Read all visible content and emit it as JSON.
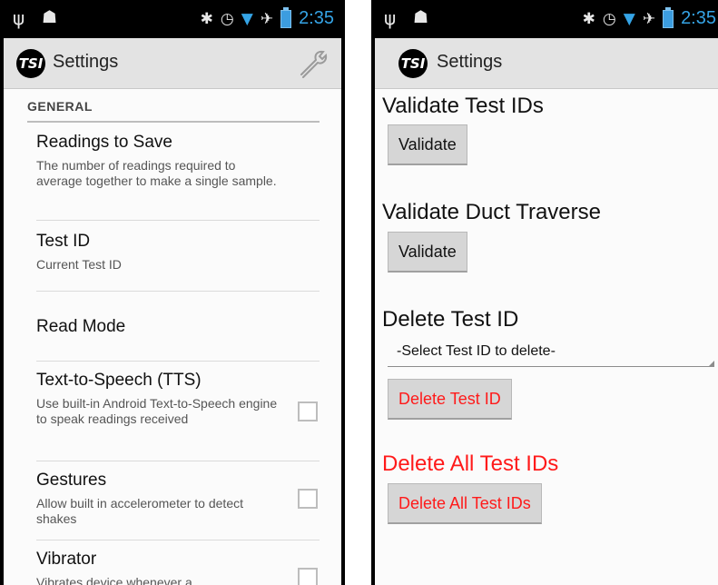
{
  "left": {
    "status": {
      "time": "2:35"
    },
    "actionbar": {
      "title": "Settings",
      "logo_text": "TSI"
    },
    "section": "GENERAL",
    "prefs": [
      {
        "title": "Readings to Save",
        "summary": "The number of readings required to average together to make a single sample."
      },
      {
        "title": "Test ID",
        "summary": "Current Test ID"
      },
      {
        "title": "Read Mode",
        "summary": ""
      },
      {
        "title": "Text-to-Speech (TTS)",
        "summary": "Use built-in Android Text-to-Speech engine to speak readings received",
        "checked": false
      },
      {
        "title": "Gestures",
        "summary": "Allow built in accelerometer to detect shakes",
        "checked": false
      },
      {
        "title": "Vibrator",
        "summary": "Vibrates device whenever a",
        "checked": false
      }
    ]
  },
  "right": {
    "status": {
      "time": "2:35"
    },
    "actionbar": {
      "title": "Settings",
      "logo_text": "TSI"
    },
    "validate_test_ids": {
      "heading": "Validate Test IDs",
      "button": "Validate"
    },
    "validate_duct": {
      "heading": "Validate Duct Traverse",
      "button": "Validate"
    },
    "delete_test_id": {
      "heading": "Delete Test ID",
      "select_value": "-Select Test ID to delete-",
      "button": "Delete Test ID"
    },
    "delete_all": {
      "heading": "Delete All Test IDs",
      "button": "Delete All Test IDs"
    }
  },
  "colors": {
    "accent_clock": "#35a4e6",
    "danger": "#ff1a1a"
  }
}
